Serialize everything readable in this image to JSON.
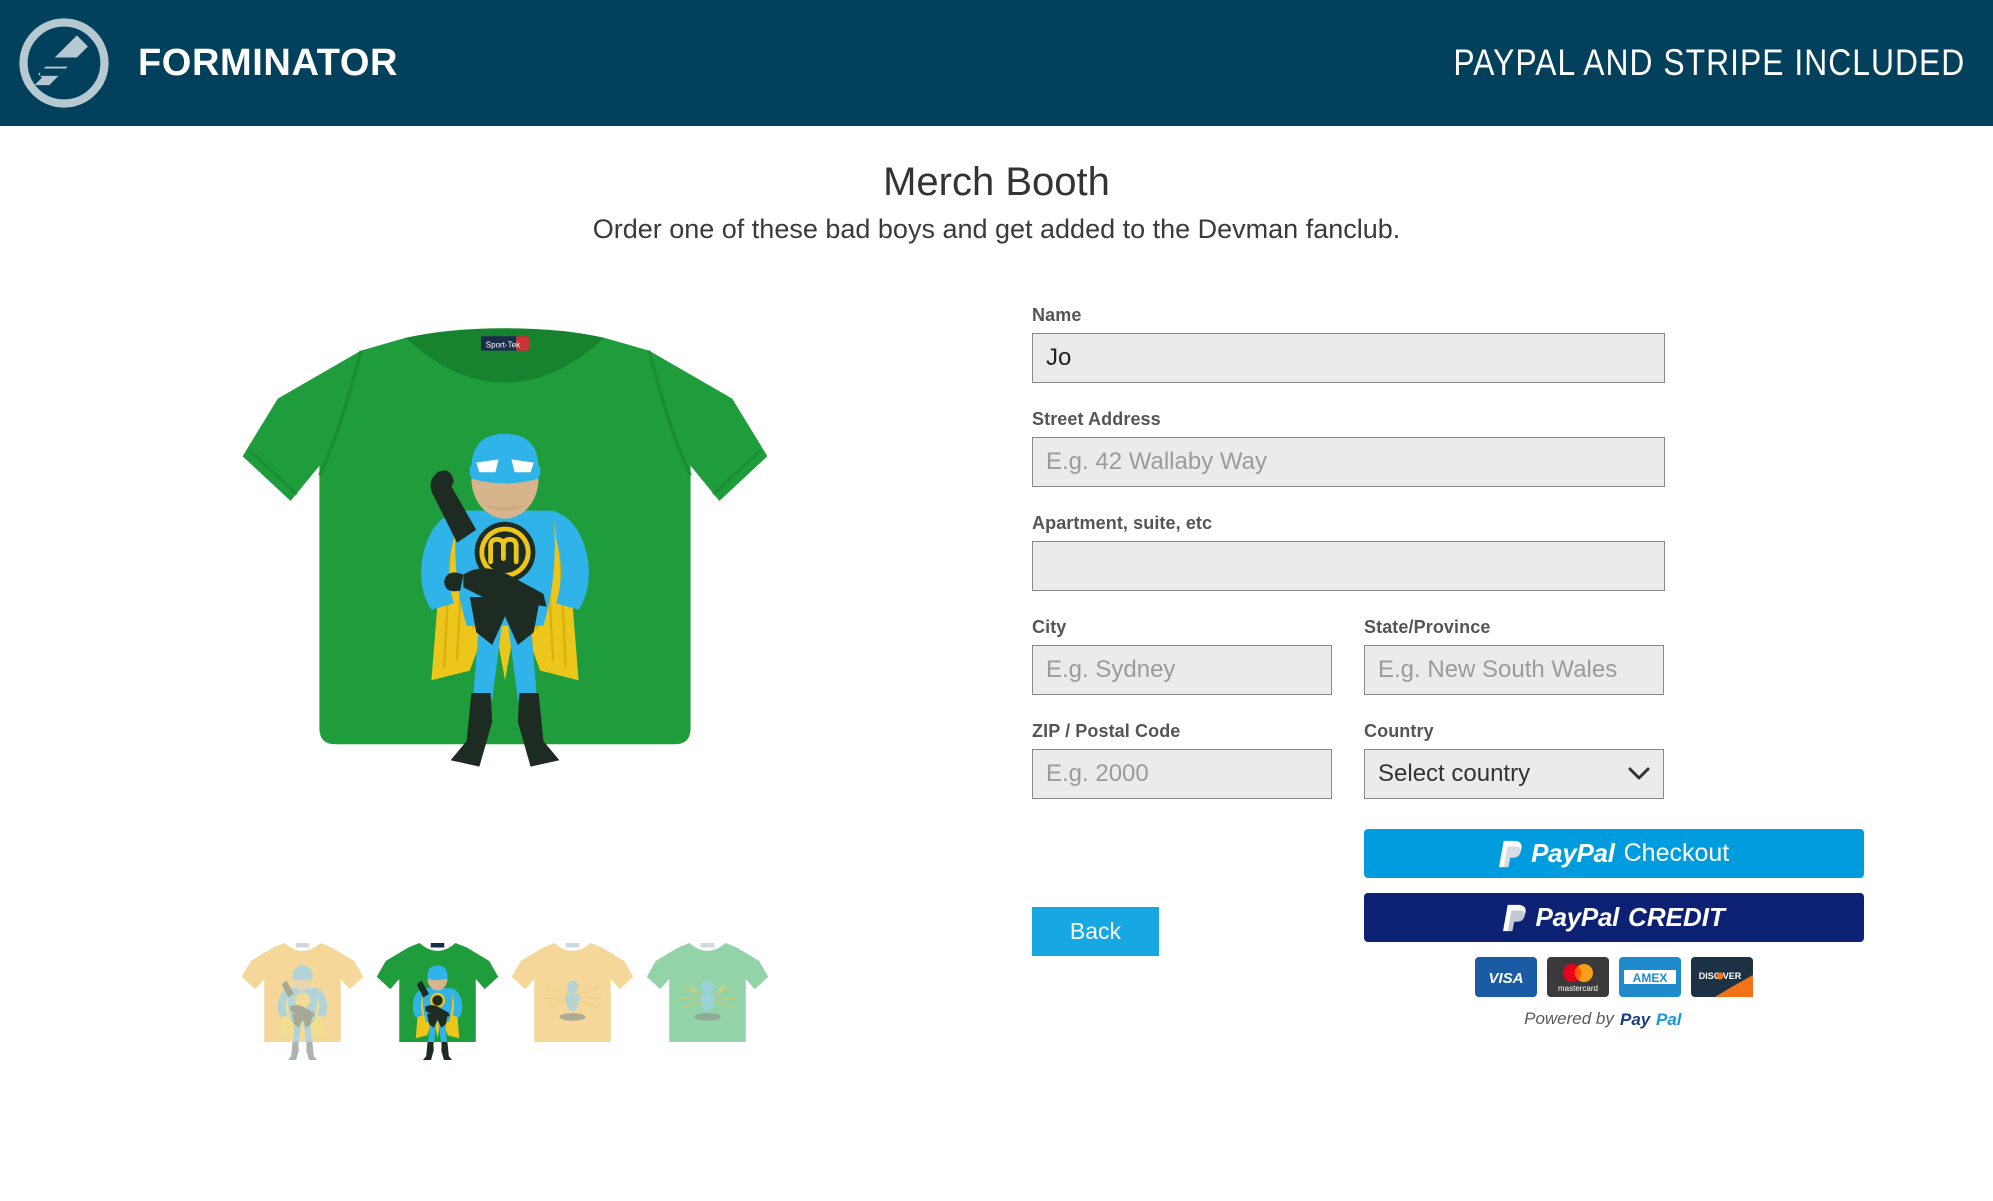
{
  "header": {
    "logo_icon": "forminator-logo-icon",
    "brand": "FORMINATOR",
    "tagline": "PAYPAL AND STRIPE INCLUDED",
    "bg_color": "#03405c",
    "text_color": "#ffffff"
  },
  "page": {
    "title": "Merch Booth",
    "subtitle": "Order one of these bad boys and get added to the Devman fanclub."
  },
  "product": {
    "hero_alt": "green-tshirt-with-devman-superhero-print",
    "hero_shirt_color": "#1f9c3c",
    "thumbnails": [
      {
        "alt": "cream-tshirt-front-thumbnail",
        "color": "#f5d79a",
        "selected": false
      },
      {
        "alt": "green-tshirt-front-thumbnail",
        "color": "#1f9c3c",
        "selected": true
      },
      {
        "alt": "cream-tshirt-back-thumbnail",
        "color": "#f5d79a",
        "selected": false
      },
      {
        "alt": "mint-tshirt-back-thumbnail",
        "color": "#93d3a8",
        "selected": false
      }
    ]
  },
  "form": {
    "name": {
      "label": "Name",
      "value": "Jo",
      "placeholder": ""
    },
    "street": {
      "label": "Street Address",
      "value": "",
      "placeholder": "E.g. 42 Wallaby Way"
    },
    "apartment": {
      "label": "Apartment, suite, etc",
      "value": "",
      "placeholder": ""
    },
    "city": {
      "label": "City",
      "value": "",
      "placeholder": "E.g. Sydney"
    },
    "state": {
      "label": "State/Province",
      "value": "",
      "placeholder": "E.g. New South Wales"
    },
    "zip": {
      "label": "ZIP / Postal Code",
      "value": "",
      "placeholder": "E.g. 2000"
    },
    "country": {
      "label": "Country",
      "selected": "Select country",
      "icon": "chevron-down-icon"
    }
  },
  "actions": {
    "back_label": "Back",
    "back_color": "#17a8e3"
  },
  "payment": {
    "checkout": {
      "brand": "PayPal",
      "suffix": "Checkout",
      "bg_color": "#009cde"
    },
    "credit": {
      "brand": "PayPal",
      "suffix": "CREDIT",
      "bg_color": "#0c2074"
    },
    "cards": [
      {
        "name": "visa-card-icon",
        "label": "VISA",
        "bg": "#1a5ba6"
      },
      {
        "name": "mastercard-card-icon",
        "label": "mastercard",
        "bg": "#3a3a3a"
      },
      {
        "name": "amex-card-icon",
        "label": "AMEX",
        "bg": "#1f8bcc"
      },
      {
        "name": "discover-card-icon",
        "label": "DISCOVER",
        "bg": "#1c3144"
      }
    ],
    "powered_by": "Powered by",
    "powered_brand": "PayPal"
  }
}
